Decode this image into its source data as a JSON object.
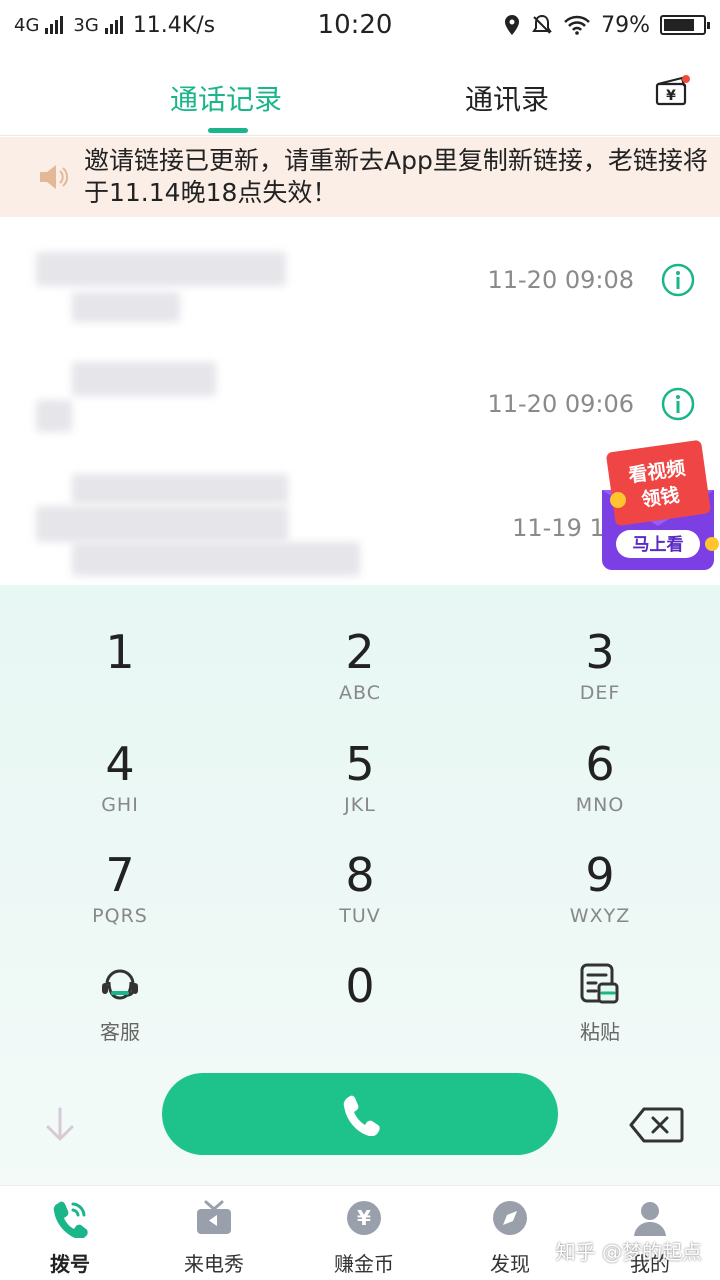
{
  "status_bar": {
    "net1": "4G",
    "net2": "3G",
    "speed": "11.4K/s",
    "time": "10:20",
    "battery": "79%",
    "battery_level": 0.79
  },
  "tabs": {
    "call_log": "通话记录",
    "contacts": "通讯录"
  },
  "notice": {
    "text": "邀请链接已更新，请重新去App里复制新链接，老链接将于11.14晚18点失效！"
  },
  "call_log": [
    {
      "time": "11-20 09:08"
    },
    {
      "time": "11-20 09:06"
    },
    {
      "time": "11-19 18"
    }
  ],
  "promo": {
    "line1": "看视频",
    "line2": "领钱",
    "button": "马上看"
  },
  "keypad": {
    "keys": [
      {
        "digit": "1",
        "letters": ""
      },
      {
        "digit": "2",
        "letters": "ABC"
      },
      {
        "digit": "3",
        "letters": "DEF"
      },
      {
        "digit": "4",
        "letters": "GHI"
      },
      {
        "digit": "5",
        "letters": "JKL"
      },
      {
        "digit": "6",
        "letters": "MNO"
      },
      {
        "digit": "7",
        "letters": "PQRS"
      },
      {
        "digit": "8",
        "letters": "TUV"
      },
      {
        "digit": "9",
        "letters": "WXYZ"
      },
      {
        "digit": "0",
        "letters": ""
      }
    ],
    "service": "客服",
    "paste": "粘贴"
  },
  "bottom_nav": [
    {
      "label": "拨号",
      "icon": "phone-icon"
    },
    {
      "label": "来电秀",
      "icon": "tv-icon"
    },
    {
      "label": "赚金币",
      "icon": "yen-coin-icon"
    },
    {
      "label": "发现",
      "icon": "compass-icon"
    },
    {
      "label": "我的",
      "icon": "user-icon"
    }
  ],
  "watermark": "知乎 @梦的起点",
  "colors": {
    "accent": "#1bb58a",
    "call_button": "#1ec38c",
    "notice_bg": "#fbeee7",
    "keypad_bg": "#e7f7f3"
  }
}
